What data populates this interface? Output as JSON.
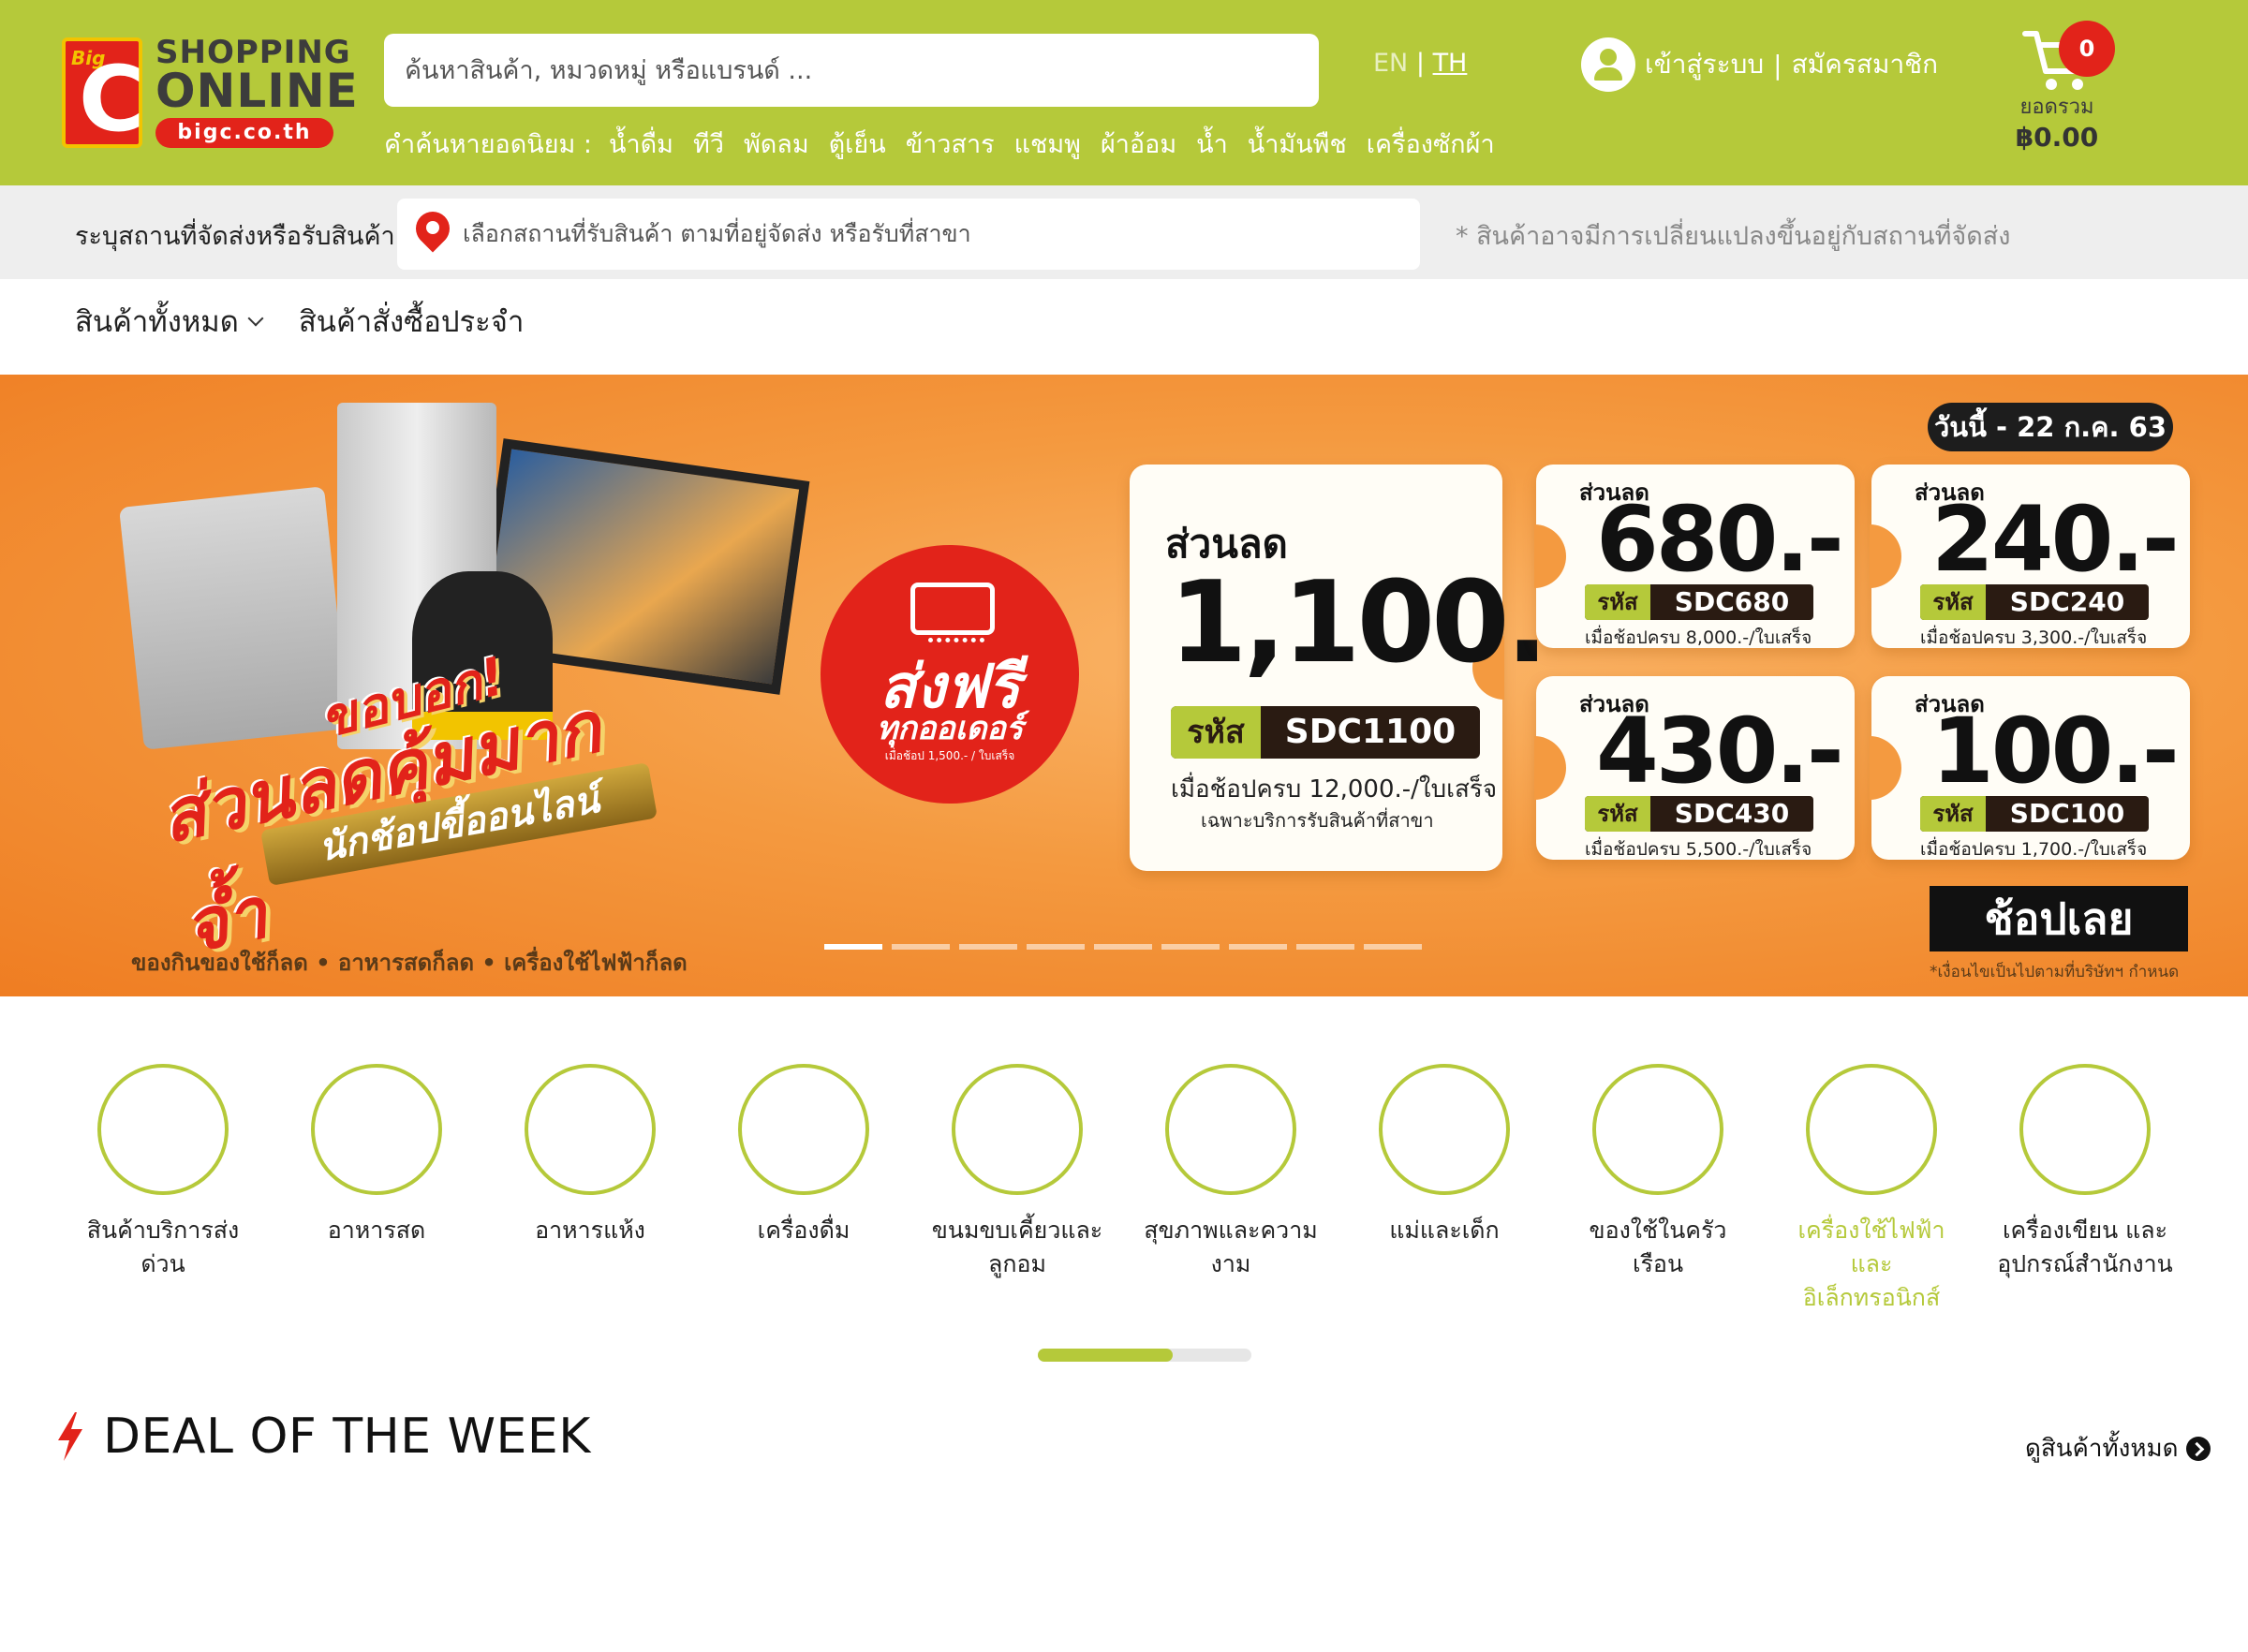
{
  "brand": {
    "logo_badge": "Big",
    "logo_letter": "C",
    "line1": "SHOPPING",
    "line2": "ONLINE",
    "domain": "bigc.co.th",
    "accent": "#b5c93a",
    "red": "#e2231a"
  },
  "search": {
    "placeholder": "ค้นหาสินค้า, หมวดหมู่ หรือแบรนด์ ..."
  },
  "popular": {
    "label": "คำค้นหายอดนิยม :",
    "keywords": [
      "น้ำดื่ม",
      "ทีวี",
      "พัดลม",
      "ตู้เย็น",
      "ข้าวสาร",
      "แชมพู",
      "ผ้าอ้อม",
      "น้ำ",
      "น้ำมันพืช",
      "เครื่องซักผ้า"
    ]
  },
  "language": {
    "en": "EN",
    "separator": "|",
    "th": "TH",
    "active": "TH"
  },
  "account": {
    "login": "เข้าสู่ระบบ",
    "separator": "|",
    "register": "สมัครสมาชิก"
  },
  "cart": {
    "count": "0",
    "total_label": "ยอดรวม",
    "total": "฿0.00"
  },
  "location": {
    "label": "ระบุสถานที่จัดส่งหรือรับสินค้า",
    "placeholder": "เลือกสถานที่รับสินค้า ตามที่อยู่จัดส่ง หรือรับที่สาขา",
    "note": "* สินค้าอาจมีการเปลี่ยนแปลงขึ้นอยู่กับสถานที่จัดส่ง"
  },
  "nav": {
    "all_products": "สินค้าทั้งหมด",
    "subscription": "สินค้าสั่งซื้อประจำ"
  },
  "banner": {
    "headline_small": "ขอบอก!",
    "headline_main": "ส่วนลดคุ้มมากจ้ำ",
    "headline_ribbon": "นักช้อปขี้ออนไลน์",
    "footer": "ของกินของใช้ก็ลด • อาหารสดก็ลด • เครื่องใช้ไฟฟ้าก็ลด",
    "free_ship_line1": "ส่งฟรี",
    "free_ship_line2": "ทุกออเดอร์",
    "free_ship_line3": "เมื่อช้อป 1,500.- / ใบเสร็จ",
    "date": "วันนี้ - 22 ก.ค. 63",
    "big_coupon": {
      "label": "ส่วนลด",
      "amount": "1,100.-",
      "code_key": "รหัส",
      "code": "SDC1100",
      "condition": "เมื่อช้อปครบ 12,000.-/ใบเสร็จ",
      "note": "เฉพาะบริการรับสินค้าที่สาขา"
    },
    "coupons": [
      {
        "label": "ส่วนลด",
        "amount": "680.-",
        "code_key": "รหัส",
        "code": "SDC680",
        "condition": "เมื่อช้อปครบ 8,000.-/ใบเสร็จ"
      },
      {
        "label": "ส่วนลด",
        "amount": "240.-",
        "code_key": "รหัส",
        "code": "SDC240",
        "condition": "เมื่อช้อปครบ 3,300.-/ใบเสร็จ"
      },
      {
        "label": "ส่วนลด",
        "amount": "430.-",
        "code_key": "รหัส",
        "code": "SDC430",
        "condition": "เมื่อช้อปครบ 5,500.-/ใบเสร็จ"
      },
      {
        "label": "ส่วนลด",
        "amount": "100.-",
        "code_key": "รหัส",
        "code": "SDC100",
        "condition": "เมื่อช้อปครบ 1,700.-/ใบเสร็จ"
      }
    ],
    "shop_now": "ช้อปเลย",
    "terms": "*เงื่อนไขเป็นไปตามที่บริษัทฯ กำหนด",
    "slides_total": 9,
    "slide_active": 1
  },
  "categories": [
    {
      "name": "สินค้าบริการส่งด่วน",
      "active": false
    },
    {
      "name": "อาหารสด",
      "active": false
    },
    {
      "name": "อาหารแห้ง",
      "active": false
    },
    {
      "name": "เครื่องดื่ม",
      "active": false
    },
    {
      "name": "ขนมขบเคี้ยวและลูกอม",
      "active": false
    },
    {
      "name": "สุขภาพและความงาม",
      "active": false
    },
    {
      "name": "แม่และเด็ก",
      "active": false
    },
    {
      "name": "ของใช้ในครัวเรือน",
      "active": false
    },
    {
      "name": "เครื่องใช้ไฟฟ้าและอิเล็กทรอนิกส์",
      "active": true
    },
    {
      "name": "เครื่องเขียน และอุปกรณ์สำนักงาน",
      "active": false
    }
  ],
  "category_scroll_fraction": 0.63,
  "deal": {
    "title": "DEAL OF THE WEEK",
    "see_all": "ดูสินค้าทั้งหมด"
  }
}
